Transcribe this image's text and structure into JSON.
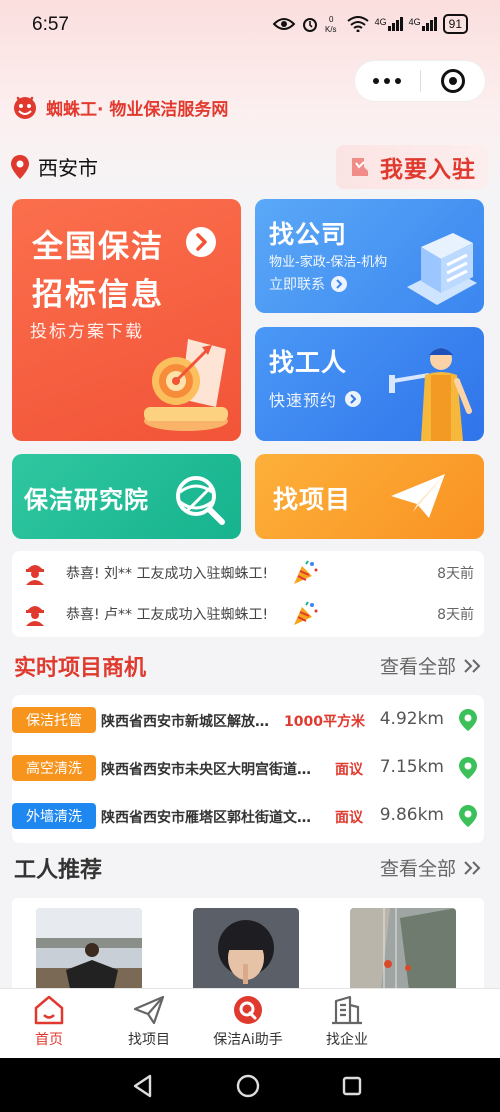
{
  "status_bar": {
    "time": "6:57",
    "network_speed": "0\nK/s",
    "signal1": "4G",
    "signal2": "4G",
    "battery": "91"
  },
  "brand": {
    "name": "蜘蛛工· 物业保洁服务网"
  },
  "location": {
    "city": "西安市"
  },
  "join_button": {
    "label": "我要入驻"
  },
  "cards": {
    "tender": {
      "title_line1": "全国保洁",
      "title_line2": "招标信息",
      "subtitle": "投标方案下载"
    },
    "company": {
      "title": "找公司",
      "desc": "物业-家政-保洁-机构",
      "action": "立即联系"
    },
    "worker": {
      "title": "找工人",
      "action": "快速预约"
    },
    "institute": {
      "title": "保洁研究院"
    },
    "project": {
      "title": "找项目"
    }
  },
  "notices": [
    {
      "text": "恭喜! 刘** 工友成功入驻蜘蛛工!",
      "time": "8天前"
    },
    {
      "text": "恭喜! 卢** 工友成功入驻蜘蛛工!",
      "time": "8天前"
    }
  ],
  "opportunities_section": {
    "title": "实时项目商机",
    "view_all": "查看全部"
  },
  "opportunities": [
    {
      "tag": "保洁托管",
      "tag_color": "#f7941d",
      "address": "陕西省西安市新城区解放…",
      "price": "1000平方米",
      "distance": "4.92km"
    },
    {
      "tag": "高空清洗",
      "tag_color": "#f7941d",
      "address": "陕西省西安市未央区大明宫街道…",
      "price": "面议",
      "distance": "7.15km"
    },
    {
      "tag": "外墙清洗",
      "tag_color": "#1e88f0",
      "address": "陕西省西安市雁塔区郭杜街道文…",
      "price": "面议",
      "distance": "9.86km"
    }
  ],
  "workers_section": {
    "title": "工人推荐",
    "view_all": "查看全部"
  },
  "tabs": [
    {
      "label": "首页",
      "icon": "home-icon",
      "active": true
    },
    {
      "label": "找项目",
      "icon": "send-icon",
      "active": false
    },
    {
      "label": "保洁Ai助手",
      "icon": "ai-assistant-icon",
      "active": false
    },
    {
      "label": "找企业",
      "icon": "building-icon",
      "active": false
    }
  ],
  "colors": {
    "brand_red": "#e03a2f",
    "tender_orange": "#f25438",
    "company_blue": "#3b86f0",
    "institute_green": "#16b38e",
    "project_orange": "#f99223",
    "pin_green": "#3cc15a"
  }
}
